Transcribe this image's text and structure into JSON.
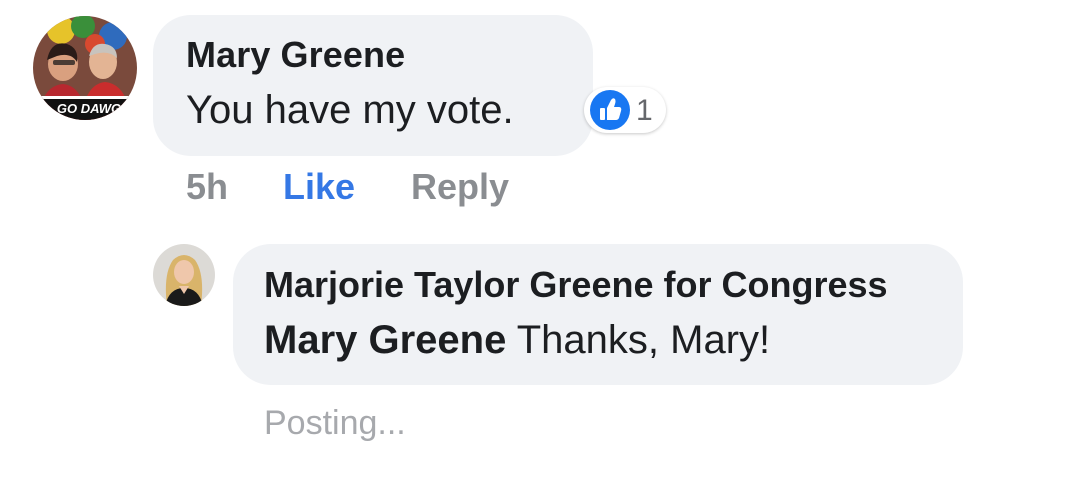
{
  "comment": {
    "author": "Mary Greene",
    "text": "You have my vote.",
    "avatar_caption": "GO DAWG",
    "time": "5h",
    "like_label": "Like",
    "reply_label": "Reply",
    "reaction": {
      "icon": "thumbs-up-icon",
      "count": "1",
      "color": "#1877f2"
    }
  },
  "reply": {
    "author": "Marjorie Taylor Greene for Congress",
    "mention": "Mary Greene",
    "text": "Thanks, Mary!",
    "status": "Posting..."
  },
  "colors": {
    "bubble": "#f0f2f5",
    "link_blue": "#3578e5",
    "muted_text": "#8a8d91",
    "primary_text": "#1c1e21"
  }
}
